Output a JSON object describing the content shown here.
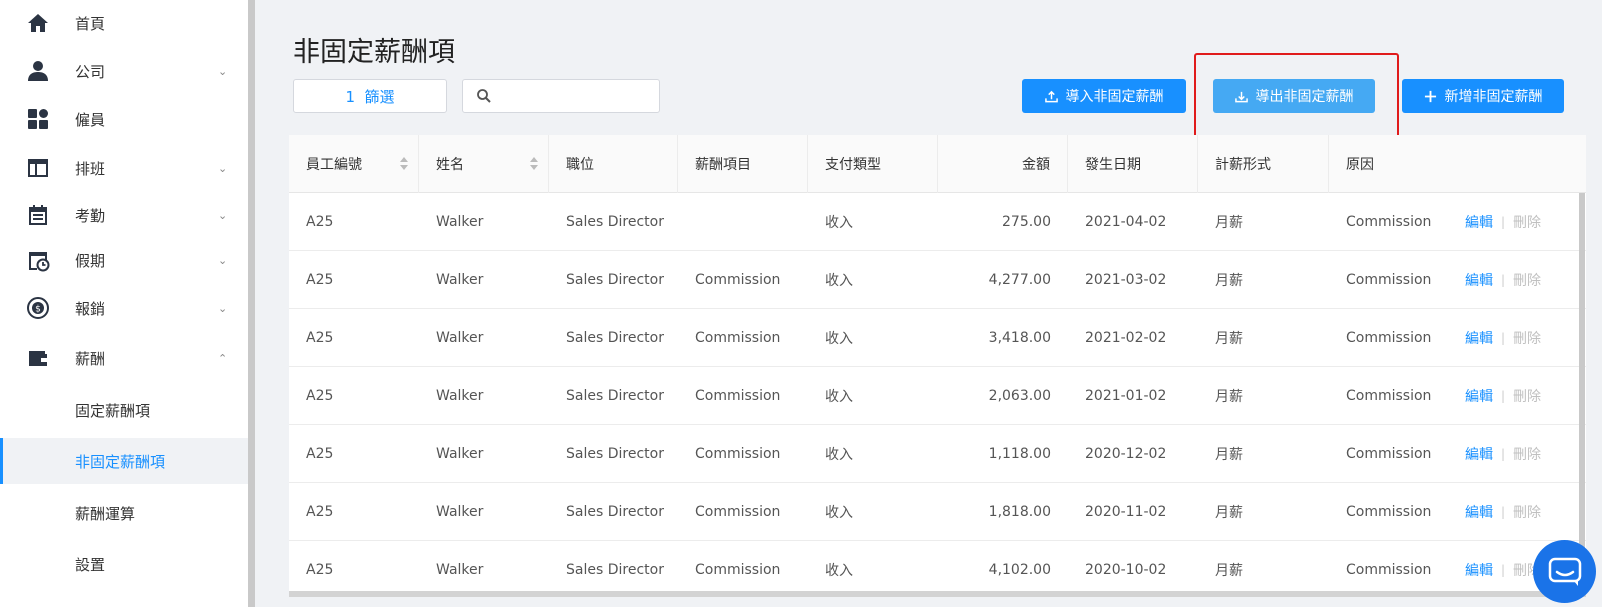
{
  "sidebar": {
    "items": [
      {
        "label": "首頁",
        "icon": "home-icon",
        "has_chevron": false
      },
      {
        "label": "公司",
        "icon": "company-icon",
        "has_chevron": true,
        "chevron": "⌄"
      },
      {
        "label": "僱員",
        "icon": "employees-icon",
        "has_chevron": false
      },
      {
        "label": "排班",
        "icon": "schedule-icon",
        "has_chevron": true,
        "chevron": "⌄"
      },
      {
        "label": "考勤",
        "icon": "attendance-icon",
        "has_chevron": true,
        "chevron": "⌄"
      },
      {
        "label": "假期",
        "icon": "leave-icon",
        "has_chevron": true,
        "chevron": "⌄"
      },
      {
        "label": "報銷",
        "icon": "reimbursement-icon",
        "has_chevron": true,
        "chevron": "⌄"
      },
      {
        "label": "薪酬",
        "icon": "wallet-icon",
        "has_chevron": true,
        "chevron": "⌃"
      }
    ],
    "sub_items": [
      {
        "label": "固定薪酬項",
        "active": false
      },
      {
        "label": "非固定薪酬項",
        "active": true
      },
      {
        "label": "薪酬運算",
        "active": false
      },
      {
        "label": "設置",
        "active": false
      }
    ]
  },
  "page": {
    "title": "非固定薪酬項"
  },
  "toolbar": {
    "filter_label": "1  篩選",
    "search_value": "",
    "import_label": "導入非固定薪酬",
    "export_label": "導出非固定薪酬",
    "add_label": "新增非固定薪酬"
  },
  "table": {
    "columns": [
      "員工編號",
      "姓名",
      "職位",
      "薪酬項目",
      "支付類型",
      "金額",
      "發生日期",
      "計薪形式",
      "原因"
    ],
    "edit_label": "編輯",
    "separator": "|",
    "delete_label": "刪除",
    "rows": [
      [
        "A25",
        "Walker",
        "Sales Director",
        "",
        "收入",
        "275.00",
        "2021-04-02",
        "月薪",
        "Commission"
      ],
      [
        "A25",
        "Walker",
        "Sales Director",
        "Commission",
        "收入",
        "4,277.00",
        "2021-03-02",
        "月薪",
        "Commission"
      ],
      [
        "A25",
        "Walker",
        "Sales Director",
        "Commission",
        "收入",
        "3,418.00",
        "2021-02-02",
        "月薪",
        "Commission"
      ],
      [
        "A25",
        "Walker",
        "Sales Director",
        "Commission",
        "收入",
        "2,063.00",
        "2021-01-02",
        "月薪",
        "Commission"
      ],
      [
        "A25",
        "Walker",
        "Sales Director",
        "Commission",
        "收入",
        "1,118.00",
        "2020-12-02",
        "月薪",
        "Commission"
      ],
      [
        "A25",
        "Walker",
        "Sales Director",
        "Commission",
        "收入",
        "1,818.00",
        "2020-11-02",
        "月薪",
        "Commission"
      ],
      [
        "A25",
        "Walker",
        "Sales Director",
        "Commission",
        "收入",
        "4,102.00",
        "2020-10-02",
        "月薪",
        "Commission"
      ]
    ]
  },
  "colors": {
    "accent": "#1890ff",
    "export_button": "#45a9f3",
    "highlight": "#e01b1b",
    "chat": "#1a73e8"
  }
}
